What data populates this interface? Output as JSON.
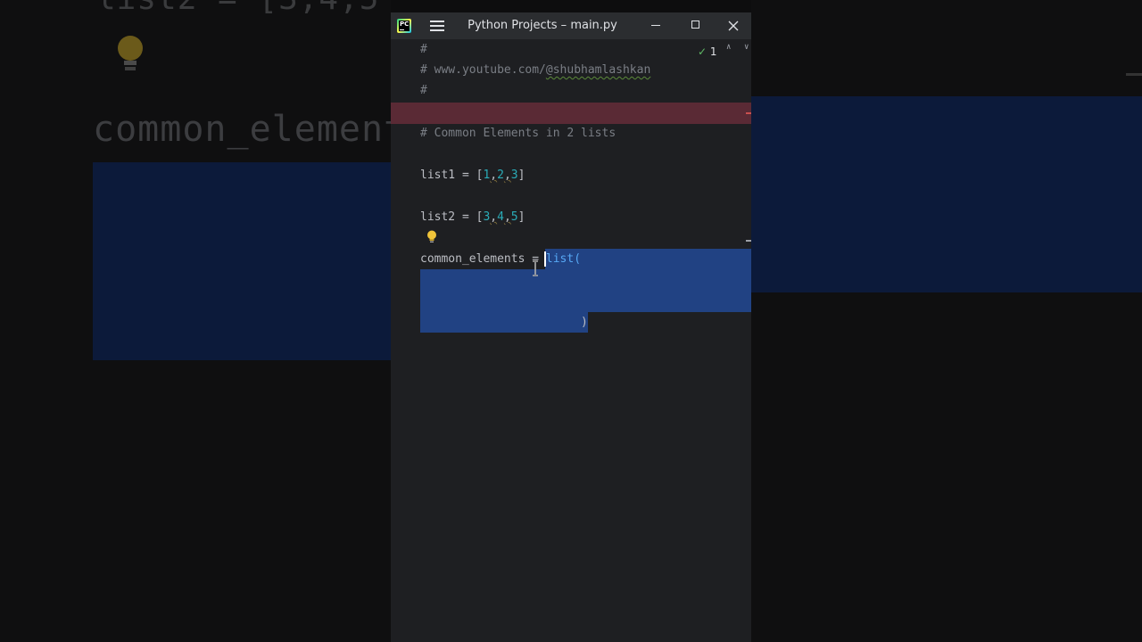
{
  "window": {
    "title": "Python Projects – main.py",
    "app_icon": "pycharm-logo",
    "app_icon_text": "PC"
  },
  "inspection": {
    "count": "1",
    "check_icon": "check-icon"
  },
  "code": {
    "line1": "#",
    "line2_prefix": "# www.youtube.com/",
    "line2_handle": "@shubhamlashkan",
    "line3": "#",
    "line4": "# Common Elements in 2 lists",
    "list1_var": "list1 = [",
    "list1_n1": "1",
    "list1_n2": "2",
    "list1_n3": "3",
    "list2_var": "list2 = [",
    "list2_n1": "3",
    "list2_n2": "4",
    "list2_n3": "5",
    "common_var": "common_elements = ",
    "common_fn": "list(",
    "close_paren": ")"
  },
  "backdrop": {
    "top_text": "list2 = [3,4,5",
    "common_text": "common_element"
  },
  "colors": {
    "editor_bg": "#1e1f22",
    "titlebar_bg": "#2b2d30",
    "selection": "#214283",
    "error_stripe": "#5a2a35",
    "comment": "#7a7e85",
    "number": "#2aacb8"
  }
}
